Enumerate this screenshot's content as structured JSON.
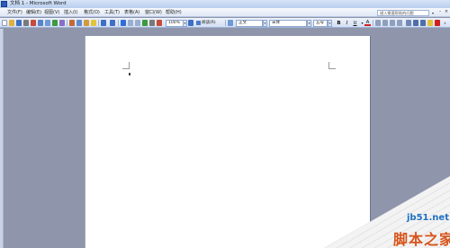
{
  "window": {
    "title": "文档 1 - Microsoft Word"
  },
  "menubar": {
    "items": [
      {
        "label": "文件(F)"
      },
      {
        "label": "编辑(E)"
      },
      {
        "label": "视图(V)"
      },
      {
        "label": "插入(I)"
      },
      {
        "label": "格式(O)"
      },
      {
        "label": "工具(T)"
      },
      {
        "label": "表格(A)"
      },
      {
        "label": "窗口(W)"
      },
      {
        "label": "帮助(H)"
      }
    ],
    "help_placeholder": "键入需要帮助的问题"
  },
  "toolbar": {
    "zoom": "100%",
    "read_mode": "阅读(R)",
    "style": "正文",
    "font": "宋体",
    "size": "五号",
    "bold": "B",
    "italic": "I",
    "underline": "U",
    "font_color": "A",
    "icon_colors": [
      "#3d6fc4",
      "#e2b03a",
      "#3c9b3c",
      "#c84a3a",
      "#7a7a7a"
    ]
  },
  "watermark": {
    "site": "jb51.net",
    "name": "脚本之家"
  }
}
